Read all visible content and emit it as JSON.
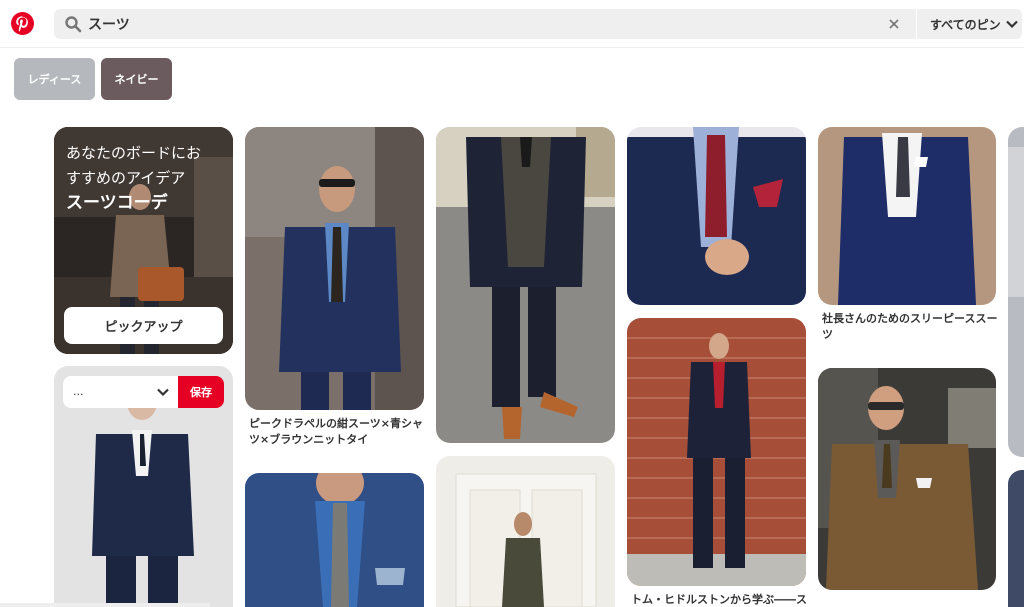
{
  "header": {
    "logo_icon": "pinterest-logo",
    "search_icon": "search-icon",
    "search_value": "スーツ",
    "clear_icon": "close-icon",
    "scope_label": "すべてのピン",
    "scope_icon": "chevron-down-icon",
    "brand_color": "#e60023"
  },
  "filters": [
    {
      "label": "レディース",
      "color": "#b5b9bd"
    },
    {
      "label": "ネイビー",
      "color": "#6b5b5e"
    }
  ],
  "promo": {
    "line1": "あなたのボードにお",
    "line2": "すすめのアイデア",
    "line3": "スーツコーデ",
    "button": "ピックアップ"
  },
  "save_overlay": {
    "board_value": "...",
    "save_label": "保存"
  },
  "pins": [
    {
      "caption_line1": "ピークドラペルの紺スーツ×青シャ",
      "caption_line2": "ツ×ブラウンニットタイ"
    },
    {
      "caption_line1": "社長さんのためのスリーピーススー",
      "caption_line2": "ツ"
    },
    {
      "caption_line1": "トム・ヒドルストンから学ぶ――スタ"
    }
  ]
}
